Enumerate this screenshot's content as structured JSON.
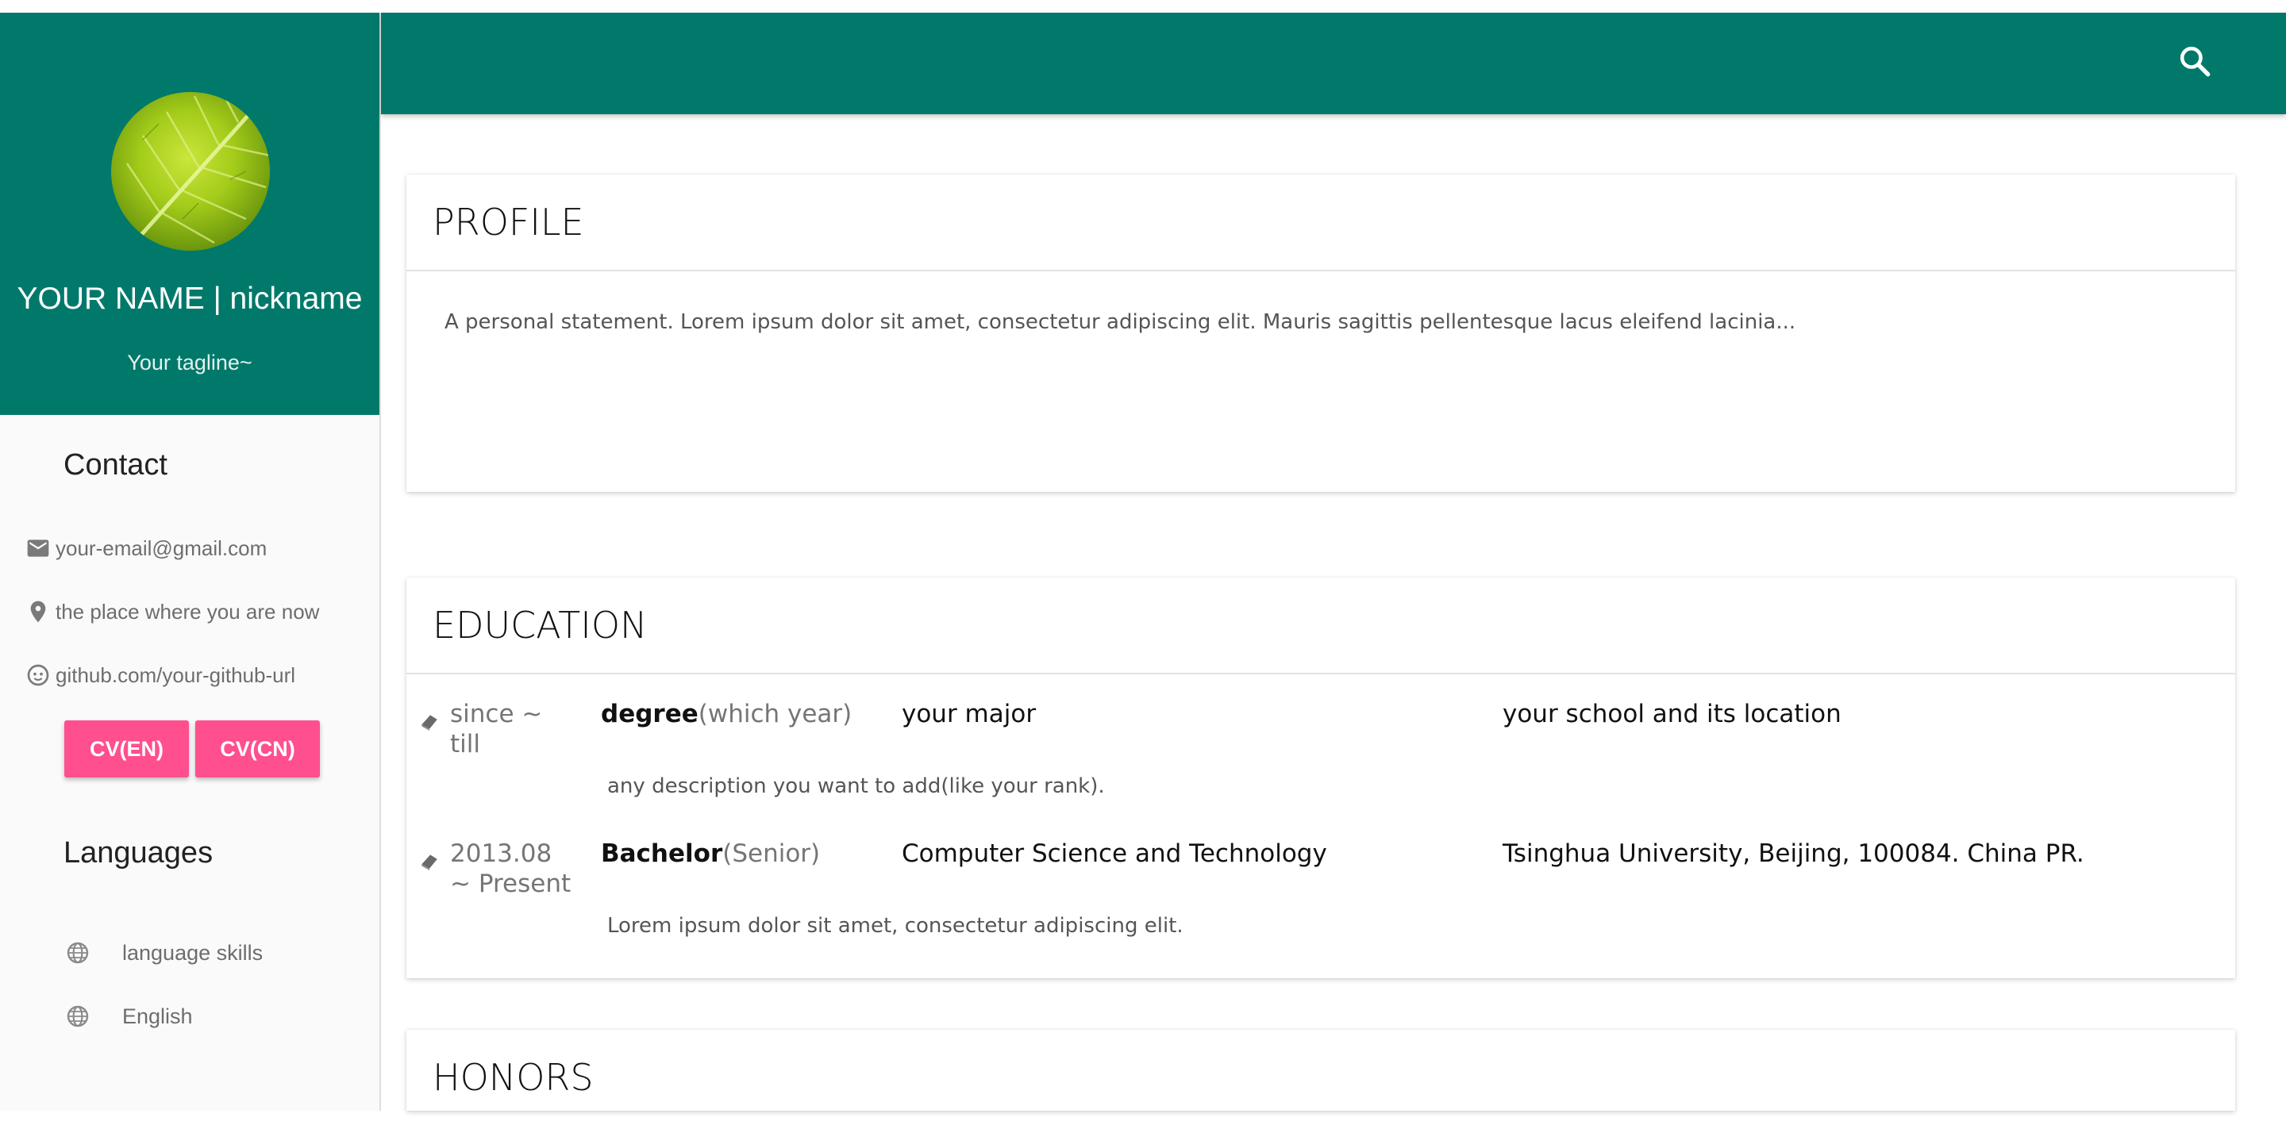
{
  "sidebar": {
    "name": "YOUR NAME | nickname",
    "tagline": "Your tagline~",
    "contact_heading": "Contact",
    "contacts": [
      {
        "icon": "email-icon",
        "text": "your-email@gmail.com"
      },
      {
        "icon": "location-pin-icon",
        "text": "the place where you are now"
      },
      {
        "icon": "github-icon",
        "text": "github.com/your-github-url"
      }
    ],
    "buttons": {
      "cv_en": "CV(EN)",
      "cv_cn": "CV(CN)"
    },
    "languages_heading": "Languages",
    "languages": [
      {
        "icon": "globe-icon",
        "text": "language skills"
      },
      {
        "icon": "globe-icon",
        "text": "English"
      }
    ]
  },
  "appbar": {
    "search_icon": "search-icon"
  },
  "profile": {
    "title": "PROFILE",
    "text": "A personal statement. Lorem ipsum dolor sit amet, consectetur adipiscing elit. Mauris sagittis pellentesque lacus eleifend lacinia..."
  },
  "education": {
    "title": "EDUCATION",
    "entries": [
      {
        "date_line1": "since ~",
        "date_line2": "till",
        "degree": "degree",
        "year": "(which year)",
        "major": "your major",
        "school": "your school and its location",
        "description": "any description you want to add(like your rank)."
      },
      {
        "date_line1": "2013.08",
        "date_line2": "~ Present",
        "degree": "Bachelor",
        "year": "(Senior)",
        "major": "Computer Science and Technology",
        "school": "Tsinghua University, Beijing, 100084. China PR.",
        "description": "Lorem ipsum dolor sit amet, consectetur adipiscing elit."
      }
    ]
  },
  "honors": {
    "title": "HONORS"
  },
  "colors": {
    "primary": "#00796b",
    "accent": "#ff4f8e",
    "sidebar_bg": "#fafafa"
  }
}
